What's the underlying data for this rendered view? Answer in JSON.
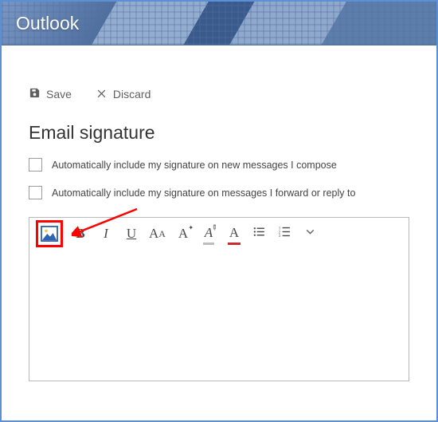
{
  "header": {
    "app_name": "Outlook"
  },
  "toolbar": {
    "save_label": "Save",
    "discard_label": "Discard"
  },
  "page": {
    "heading": "Email signature",
    "option_new": "Automatically include my signature on new messages I compose",
    "option_reply": "Automatically include my signature on messages I forward or reply to"
  },
  "format": {
    "bold": "B",
    "italic": "I",
    "underline": "U",
    "font_size": "AA",
    "font_style": "A",
    "highlight": "A",
    "font_color": "A"
  }
}
